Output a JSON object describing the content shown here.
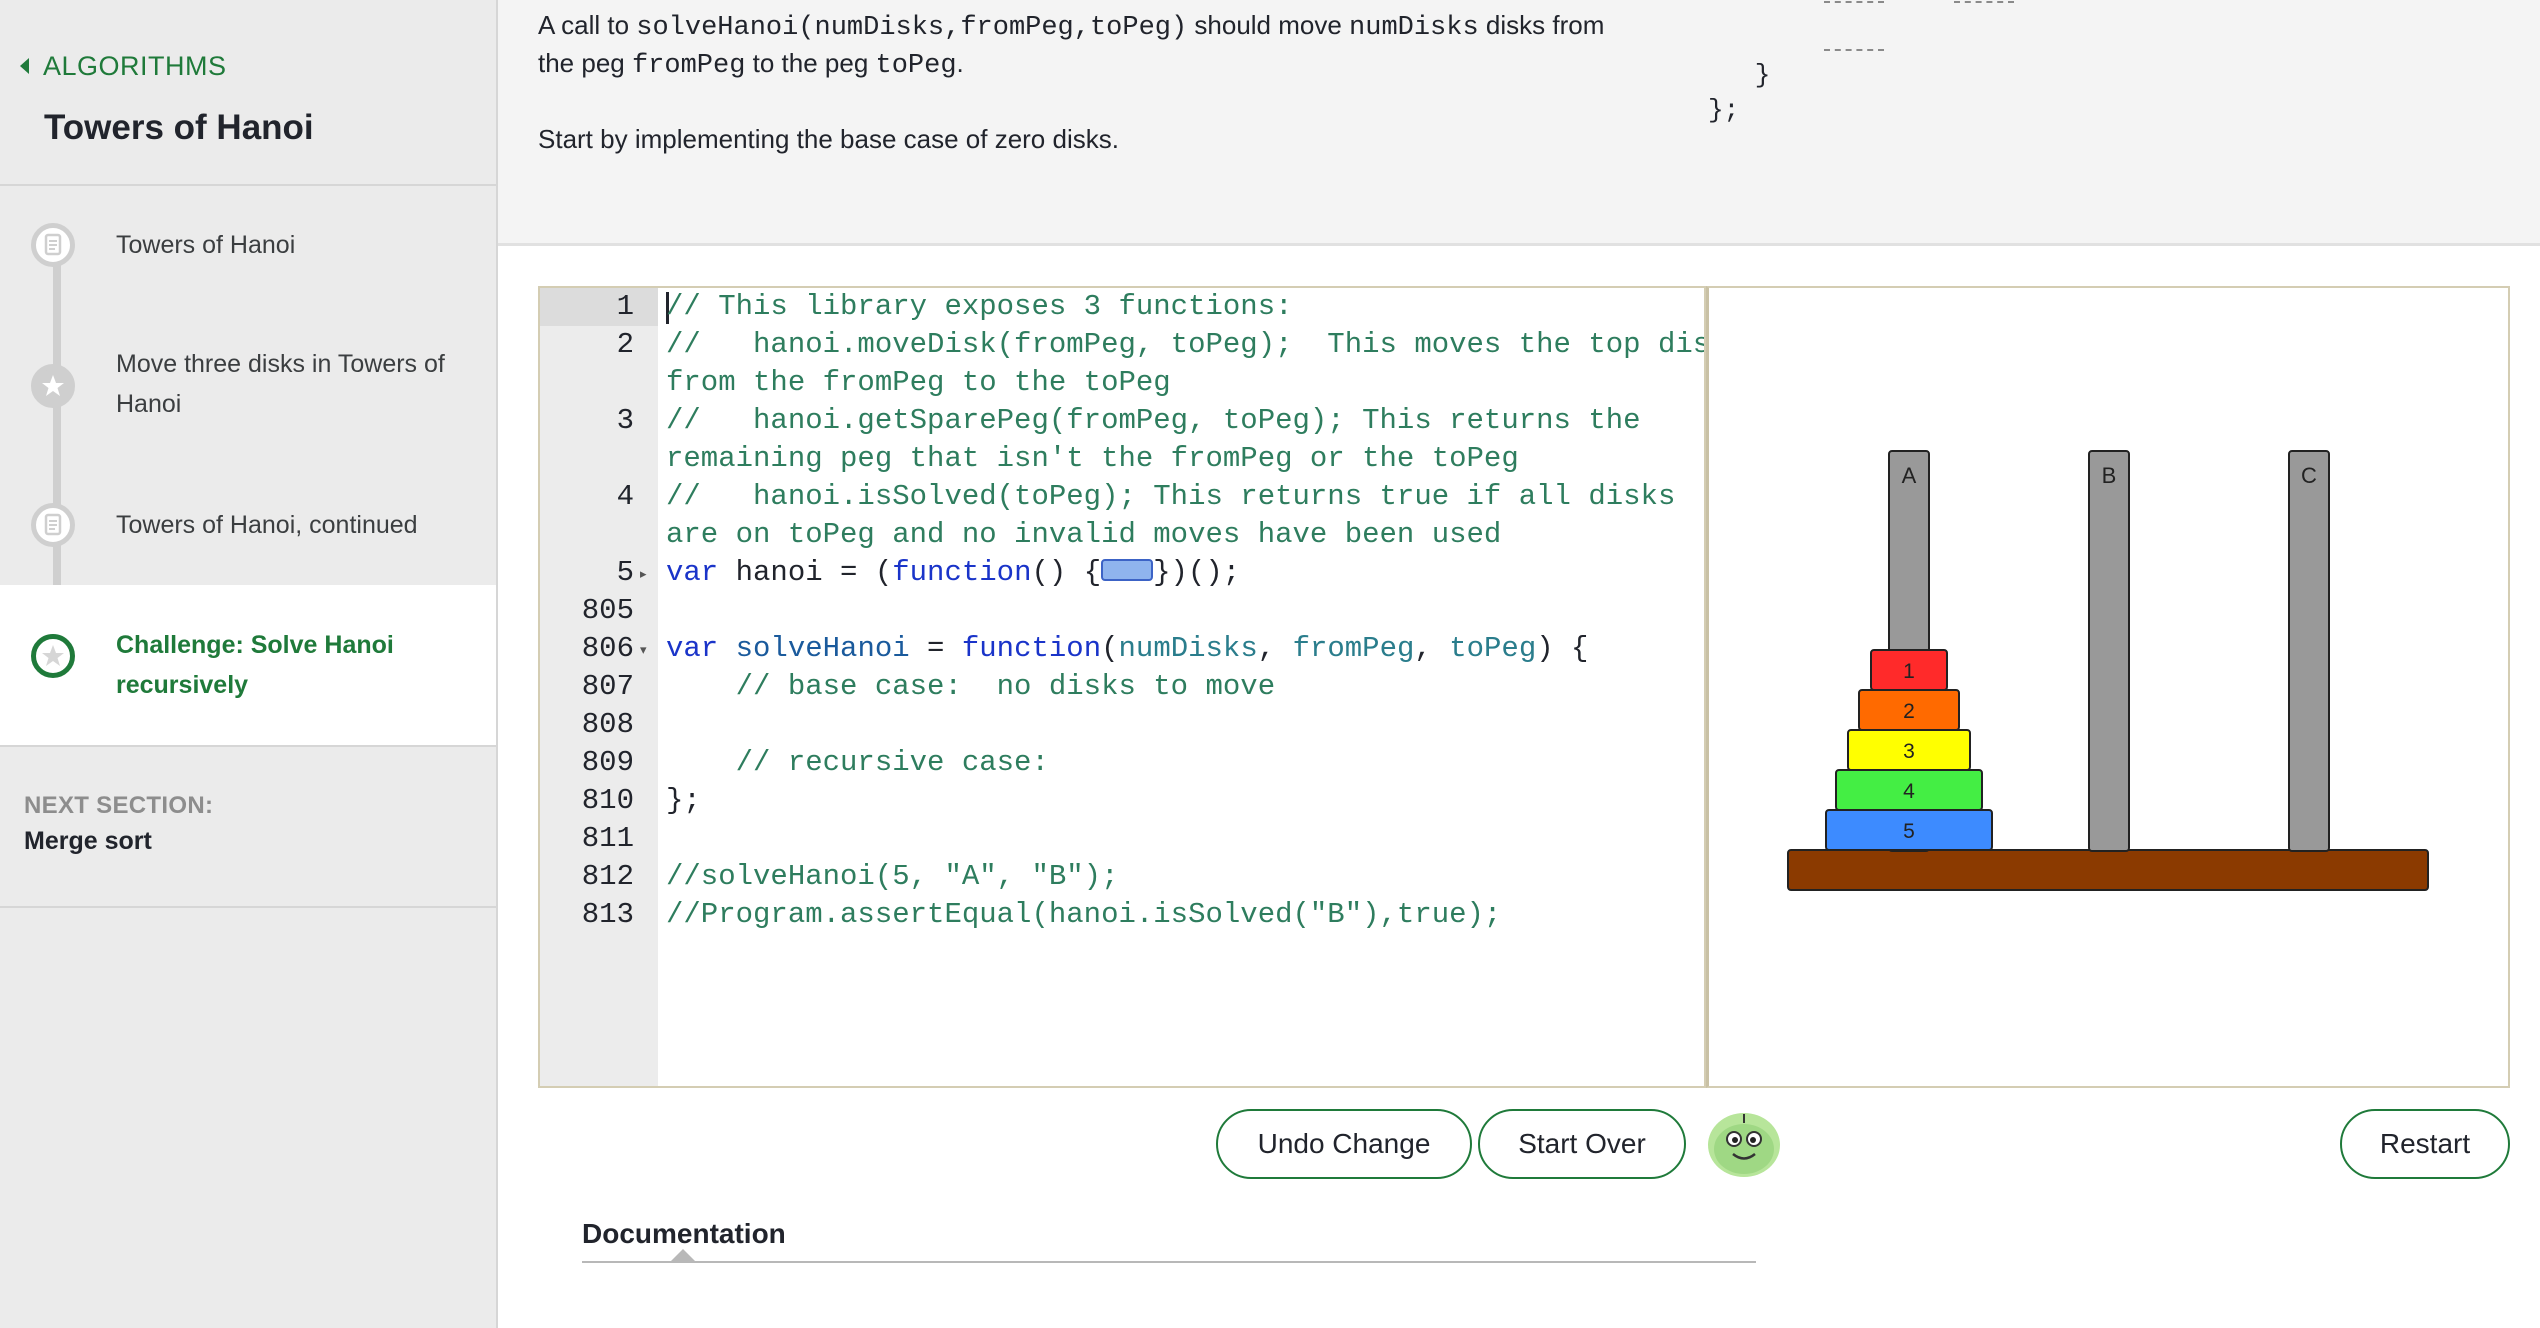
{
  "sidebar": {
    "back_label": "ALGORITHMS",
    "tutorial_title": "Towers of Hanoi",
    "steps": [
      {
        "label": "Towers of Hanoi",
        "icon": "article-icon"
      },
      {
        "label": "Move three disks in Towers of Hanoi",
        "icon": "star-icon"
      },
      {
        "label": "Towers of Hanoi, continued",
        "icon": "article-icon"
      },
      {
        "label": "Challenge: Solve Hanoi recursively",
        "icon": "star-icon",
        "active": true
      }
    ],
    "next_section_label": "NEXT SECTION:",
    "next_section_title": "Merge sort"
  },
  "instructions": {
    "line1_a": "A call to ",
    "line1_code1": "solveHanoi(numDisks,fromPeg,toPeg)",
    "line1_b": " should move ",
    "line1_code2": "numDisks",
    "line1_c": " disks from",
    "line2_a": "the peg ",
    "line2_code1": "fromPeg",
    "line2_b": " to the peg ",
    "line2_code2": "toPeg",
    "line2_c": ".",
    "line3": "Start by implementing the base case of zero disks.",
    "sample_code": "   }\n};"
  },
  "editor": {
    "gutter": [
      "1",
      "2",
      "3",
      "4",
      "5",
      "805",
      "806",
      "807",
      "808",
      "809",
      "810",
      "811",
      "812",
      "813"
    ],
    "lines": {
      "l1": "// This library exposes 3 functions:",
      "l2a": "//   hanoi.moveDisk(fromPeg, toPeg);  This moves the top disk",
      "l2b": "from the fromPeg to the toPeg",
      "l3a": "//   hanoi.getSparePeg(fromPeg, toPeg); This returns the",
      "l3b": "remaining peg that isn't the fromPeg or the toPeg",
      "l4a": "//   hanoi.isSolved(toPeg); This returns true if all disks",
      "l4b": "are on toPeg and no invalid moves have been used",
      "l5_kw": "var",
      "l5_name": " hanoi = (",
      "l5_fn": "function",
      "l5_rest1": "() {",
      "l5_rest2": "})();",
      "l806_kw": "var",
      "l806_name": " solveHanoi",
      "l806_eq": " = ",
      "l806_fn": "function",
      "l806_open": "(",
      "l806_p1": "numDisks",
      "l806_c1": ", ",
      "l806_p2": "fromPeg",
      "l806_c2": ", ",
      "l806_p3": "toPeg",
      "l806_close": ") {",
      "l807": "    // base case:  no disks to move",
      "l809": "    // recursive case:",
      "l810": "};",
      "l812": "//solveHanoi(5, \"A\", \"B\");",
      "l813": "//Program.assertEqual(hanoi.isSolved(\"B\"),true);"
    }
  },
  "canvas": {
    "pegs": [
      "A",
      "B",
      "C"
    ],
    "disks": [
      {
        "label": "1",
        "color": "#ff2a2a"
      },
      {
        "label": "2",
        "color": "#ff6a00"
      },
      {
        "label": "3",
        "color": "#ffff00"
      },
      {
        "label": "4",
        "color": "#44ee44"
      },
      {
        "label": "5",
        "color": "#3d8bff"
      }
    ],
    "base_color": "#8b3a00",
    "peg_color": "#999999"
  },
  "buttons": {
    "undo": "Undo Change",
    "start_over": "Start Over",
    "restart": "Restart"
  },
  "docs": {
    "tab_label": "Documentation"
  },
  "colors": {
    "accent": "#1f7a3a"
  }
}
